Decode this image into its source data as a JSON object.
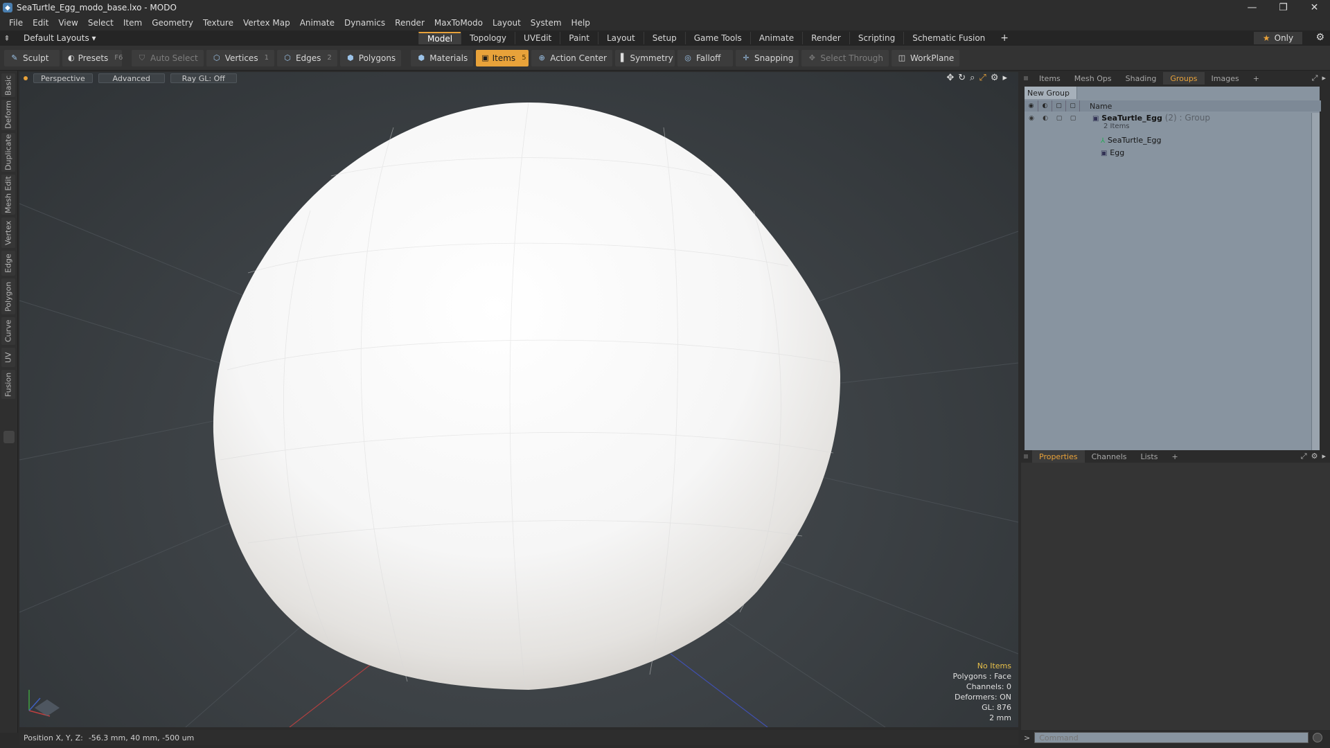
{
  "window": {
    "title": "SeaTurtle_Egg_modo_base.lxo - MODO",
    "minimize": "—",
    "maximize": "❐",
    "close": "✕"
  },
  "menu": [
    "File",
    "Edit",
    "View",
    "Select",
    "Item",
    "Geometry",
    "Texture",
    "Vertex Map",
    "Animate",
    "Dynamics",
    "Render",
    "MaxToModo",
    "Layout",
    "System",
    "Help"
  ],
  "layoutbar": {
    "layout_select": "Default Layouts ▾",
    "tabs": [
      "Model",
      "Topology",
      "UVEdit",
      "Paint",
      "Layout",
      "Setup",
      "Game Tools",
      "Animate",
      "Render",
      "Scripting",
      "Schematic Fusion"
    ],
    "active_tab": "Model",
    "only_label": "Only"
  },
  "toolbar": {
    "sculpt": "Sculpt",
    "presets": "Presets",
    "presets_key": "F6",
    "auto_select": "Auto Select",
    "vertices": "Vertices",
    "vertices_count": "1",
    "edges": "Edges",
    "edges_count": "2",
    "polygons": "Polygons",
    "materials": "Materials",
    "items": "Items",
    "items_count": "5",
    "action_center": "Action Center",
    "symmetry": "Symmetry",
    "falloff": "Falloff",
    "snapping": "Snapping",
    "select_through": "Select Through",
    "workplane": "WorkPlane"
  },
  "lefttabs": [
    "Basic",
    "Deform",
    "Duplicate",
    "Mesh Edit",
    "Vertex",
    "Edge",
    "Polygon",
    "Curve",
    "UV",
    "Fusion"
  ],
  "viewport": {
    "view_mode": "Perspective",
    "shading": "Advanced",
    "raygl": "Ray GL: Off",
    "info": {
      "no_items": "No Items",
      "polygons": "Polygons : Face",
      "channels": "Channels: 0",
      "deformers": "Deformers: ON",
      "gl": "GL: 876",
      "scale": "2 mm"
    }
  },
  "status": {
    "label": "Position X, Y, Z:",
    "value": "-56.3 mm, 40 mm, -500 um"
  },
  "groups_panel": {
    "tabs": [
      "Items",
      "Mesh Ops",
      "Shading",
      "Groups",
      "Images"
    ],
    "active_tab": "Groups",
    "new_group": "New Group",
    "name_header": "Name",
    "group": {
      "name": "SeaTurtle_Egg",
      "count": "(2)",
      "type": ": Group",
      "items_label": "2 Items"
    },
    "children": [
      "SeaTurtle_Egg",
      "Egg"
    ]
  },
  "props_panel": {
    "tabs": [
      "Properties",
      "Channels",
      "Lists"
    ],
    "active_tab": "Properties"
  },
  "command": {
    "placeholder": "Command"
  },
  "colors": {
    "accent": "#e8a23a",
    "viewport_bg": "#3d4246",
    "panel_bg": "#8894a0"
  }
}
